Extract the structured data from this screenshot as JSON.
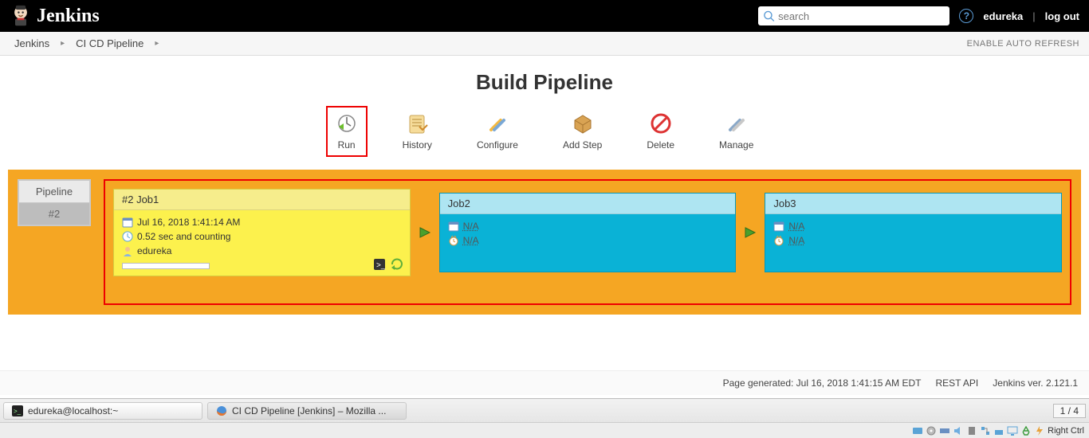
{
  "header": {
    "brand": "Jenkins",
    "search_placeholder": "search",
    "user": "edureka",
    "logout": "log out"
  },
  "breadcrumb": {
    "items": [
      "Jenkins",
      "CI CD Pipeline"
    ],
    "auto_refresh": "ENABLE AUTO REFRESH"
  },
  "title": "Build Pipeline",
  "toolbar": {
    "run": "Run",
    "history": "History",
    "configure": "Configure",
    "add_step": "Add Step",
    "delete": "Delete",
    "manage": "Manage"
  },
  "pipeline": {
    "label": "Pipeline",
    "number": "#2",
    "stages": [
      {
        "title": "#2 Job1",
        "date": "Jul 16, 2018 1:41:14 AM",
        "duration": "0.52 sec and counting",
        "user": "edureka"
      },
      {
        "title": "Job2",
        "na1": "N/A",
        "na2": "N/A"
      },
      {
        "title": "Job3",
        "na1": "N/A",
        "na2": "N/A"
      }
    ]
  },
  "footer": {
    "generated": "Page generated: Jul 16, 2018 1:41:15 AM EDT",
    "rest_api": "REST API",
    "version": "Jenkins ver. 2.121.1"
  },
  "taskbar": {
    "terminal": "edureka@localhost:~",
    "browser": "CI CD Pipeline [Jenkins] – Mozilla ...",
    "pager": "1 / 4",
    "tray_label": "Right Ctrl"
  }
}
